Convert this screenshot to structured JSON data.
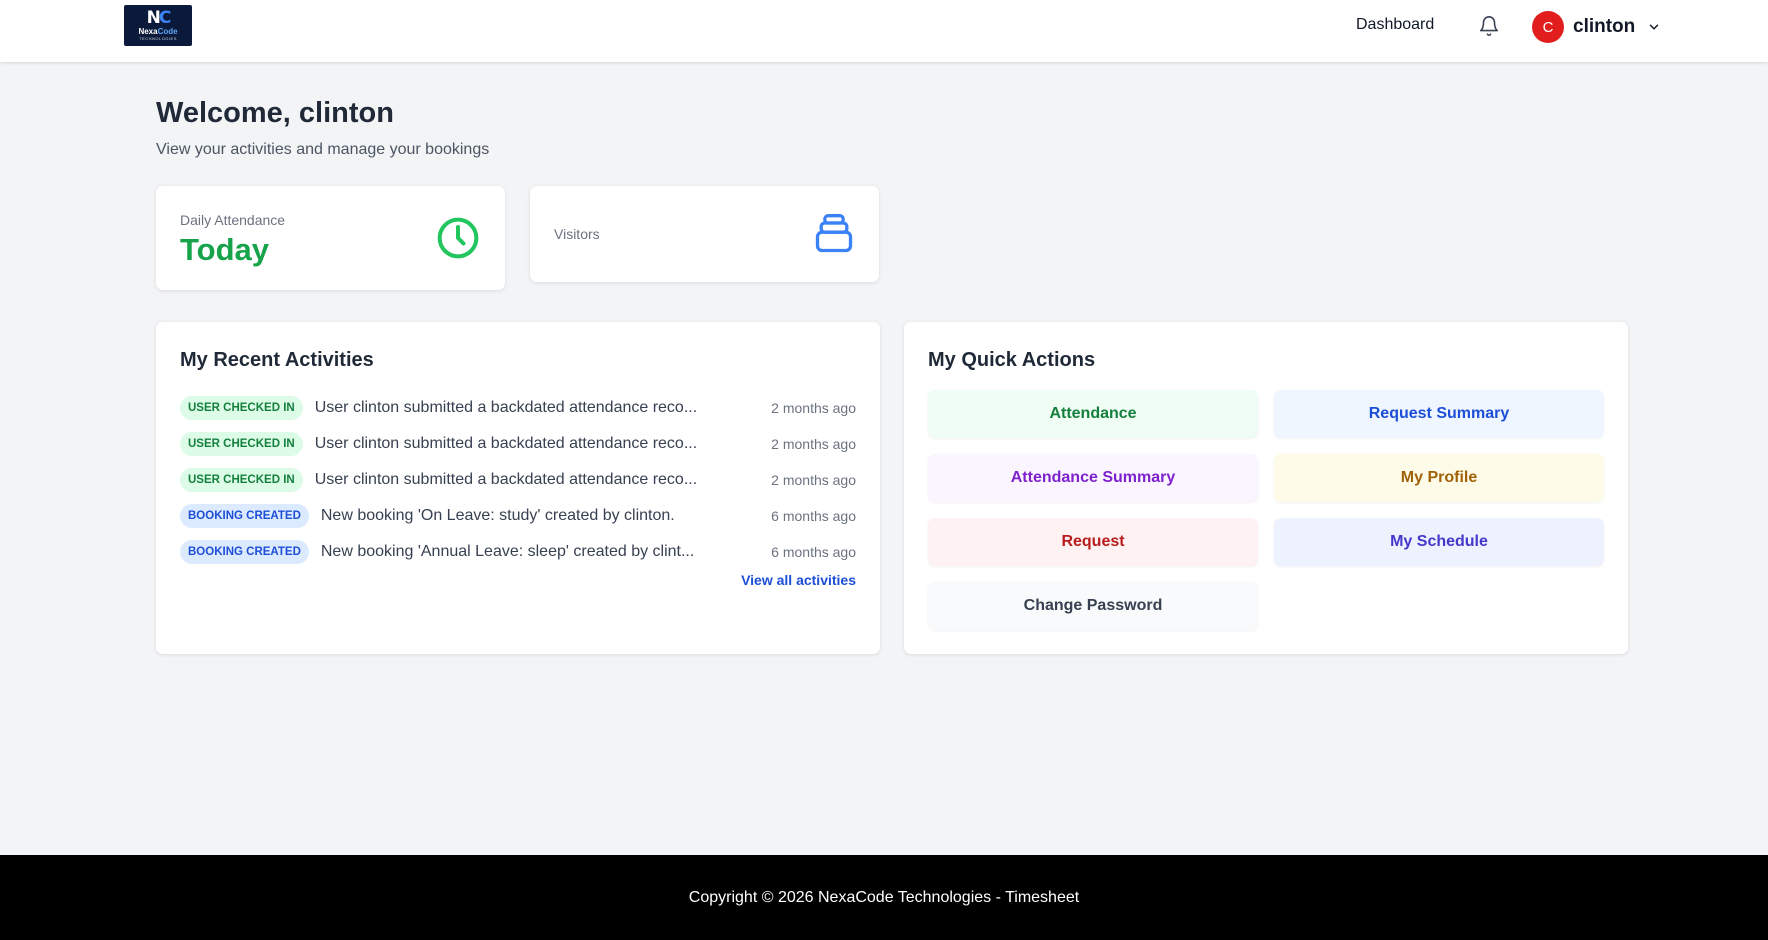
{
  "header": {
    "logo": {
      "mark": "NC",
      "name_part1": "Nexa",
      "name_part2": "Code",
      "tagline": "TECHNOLOGIES"
    },
    "nav_dashboard": "Dashboard",
    "notifications_icon": "bell-icon",
    "user": {
      "initial": "C",
      "name": "clinton",
      "menu_icon": "chevron-down-icon",
      "avatar_color": "#e11d1d"
    }
  },
  "welcome": {
    "title": "Welcome, clinton",
    "subtitle": "View your activities and manage your bookings"
  },
  "stats": {
    "attendance": {
      "label": "Daily Attendance",
      "value": "Today",
      "icon": "clock-icon",
      "color": "#16a34a"
    },
    "visitors": {
      "label": "Visitors",
      "icon": "inbox-stack-icon",
      "color": "#3b82f6"
    }
  },
  "activities": {
    "title": "My Recent Activities",
    "items": [
      {
        "badge": "USER CHECKED IN",
        "type": "green",
        "text": "User clinton submitted a backdated attendance reco...",
        "time": "2 months ago"
      },
      {
        "badge": "USER CHECKED IN",
        "type": "green",
        "text": "User clinton submitted a backdated attendance reco...",
        "time": "2 months ago"
      },
      {
        "badge": "USER CHECKED IN",
        "type": "green",
        "text": "User clinton submitted a backdated attendance reco...",
        "time": "2 months ago"
      },
      {
        "badge": "BOOKING CREATED",
        "type": "blue",
        "text": "New booking 'On Leave: study' created by clinton.",
        "time": "6 months ago"
      },
      {
        "badge": "BOOKING CREATED",
        "type": "blue",
        "text": "New booking 'Annual Leave: sleep' created by clint...",
        "time": "6 months ago"
      }
    ],
    "view_all": "View all activities"
  },
  "quick_actions": {
    "title": "My Quick Actions",
    "attendance": "Attendance",
    "request_summary": "Request Summary",
    "attendance_summary": "Attendance Summary",
    "my_profile": "My Profile",
    "request": "Request",
    "my_schedule": "My Schedule",
    "change_password": "Change Password"
  },
  "footer": {
    "text": "Copyright © 2026 NexaCode Technologies - Timesheet"
  }
}
